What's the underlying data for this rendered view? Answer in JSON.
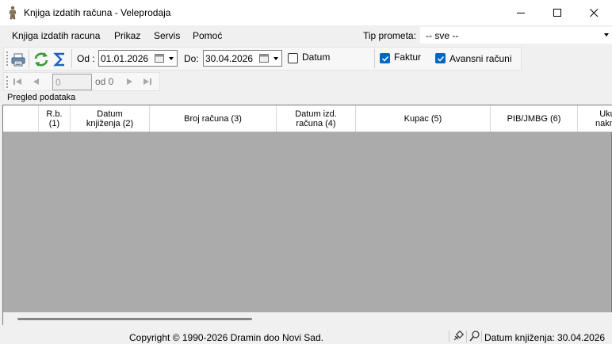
{
  "window": {
    "title": "Knjiga izdatih računa - Veleprodaja",
    "icons": {
      "app": "person-figure-icon",
      "minimize": "minimize-icon",
      "maximize": "maximize-icon",
      "close": "close-icon"
    }
  },
  "menu": {
    "items": [
      "Knjiga izdatih racuna",
      "Prikaz",
      "Servis",
      "Pomoć"
    ],
    "tip_prometa_label": "Tip prometa:",
    "tip_prometa_value": "-- sve --"
  },
  "toolbar": {
    "od_label": "Od :",
    "od_value": "01.01.2026",
    "do_label": "Do:",
    "do_value": "30.04.2026",
    "datum_label": "Datum",
    "datum_checked": false,
    "faktur_label": "Faktur",
    "faktur_checked": true,
    "avansni_label": "Avansni računi",
    "avansni_checked": true,
    "icons": [
      "printer-icon",
      "refresh-icon",
      "sum-icon",
      "calendar-icon"
    ]
  },
  "navigator": {
    "position_value": "0",
    "of_label": "od 0",
    "icons": [
      "first-record-icon",
      "previous-record-icon",
      "next-record-icon",
      "last-record-icon"
    ]
  },
  "section": {
    "label": "Pregled podataka"
  },
  "grid": {
    "columns": [
      {
        "lines": [
          "",
          ""
        ]
      },
      {
        "lines": [
          "R.b.",
          "(1)"
        ]
      },
      {
        "lines": [
          "Datum",
          "knjiženja (2)"
        ]
      },
      {
        "lines": [
          "Broj računa (3)"
        ]
      },
      {
        "lines": [
          "Datum izd.",
          "računa (4)"
        ]
      },
      {
        "lines": [
          "Kupac (5)"
        ]
      },
      {
        "lines": [
          "PIB/JMBG (6)"
        ]
      },
      {
        "lines": [
          "Uku",
          "nakna"
        ]
      }
    ],
    "rows": []
  },
  "status": {
    "copyright": "Copyright © 1990-2026 Dramin doo Novi Sad.",
    "datum_knjizenja": "Datum knjiženja: 30.04.2026",
    "icons": [
      "pin-icon",
      "search-icon"
    ]
  },
  "colors": {
    "accent": "#0067c0",
    "grid_bg": "#ababab",
    "window_bg": "#f0f0f0"
  }
}
